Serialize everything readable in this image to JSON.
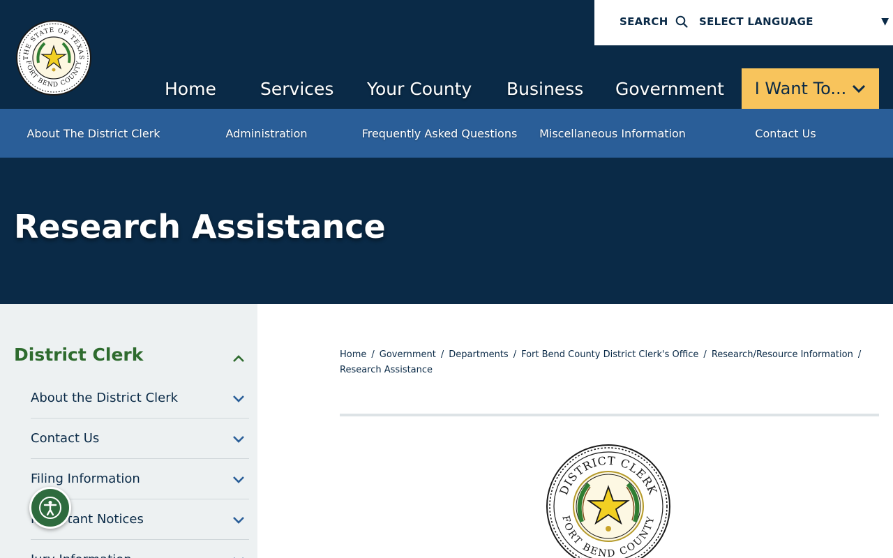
{
  "header": {
    "search_label": "SEARCH",
    "language_label": "SELECT LANGUAGE",
    "logo_text_top": "THE STATE OF TEXAS",
    "logo_text_bottom": "FORT BEND COUNTY"
  },
  "main_nav": {
    "items": [
      {
        "label": "Home"
      },
      {
        "label": "Services"
      },
      {
        "label": "Your County"
      },
      {
        "label": "Business"
      },
      {
        "label": "Government"
      }
    ],
    "cta_label": "I Want To..."
  },
  "sub_nav": {
    "items": [
      {
        "label": "About The District Clerk"
      },
      {
        "label": "Administration"
      },
      {
        "label": "Frequently Asked Questions"
      },
      {
        "label": "Miscellaneous Information"
      },
      {
        "label": "Contact Us"
      }
    ]
  },
  "hero": {
    "title": "Research Assistance"
  },
  "sidebar": {
    "heading": "District Clerk",
    "items": [
      {
        "label": "About the District Clerk"
      },
      {
        "label": "Contact Us"
      },
      {
        "label": "Filing Information"
      },
      {
        "label": "Important Notices"
      },
      {
        "label": "Jury Information"
      }
    ]
  },
  "breadcrumb": {
    "items": [
      {
        "label": "Home"
      },
      {
        "label": "Government"
      },
      {
        "label": "Departments"
      },
      {
        "label": "Fort Bend County District Clerk's Office"
      },
      {
        "label": "Research/Resource Information"
      }
    ],
    "current": "Research Assistance"
  },
  "seal": {
    "text_top": "DISTRICT CLERK",
    "text_bottom": "FORT BEND COUNTY"
  },
  "colors": {
    "navy": "#0a2a47",
    "blue": "#2a5e98",
    "gold": "#f8c45c",
    "green": "#2e6b2e",
    "sidebar_bg": "#edf1f2"
  }
}
